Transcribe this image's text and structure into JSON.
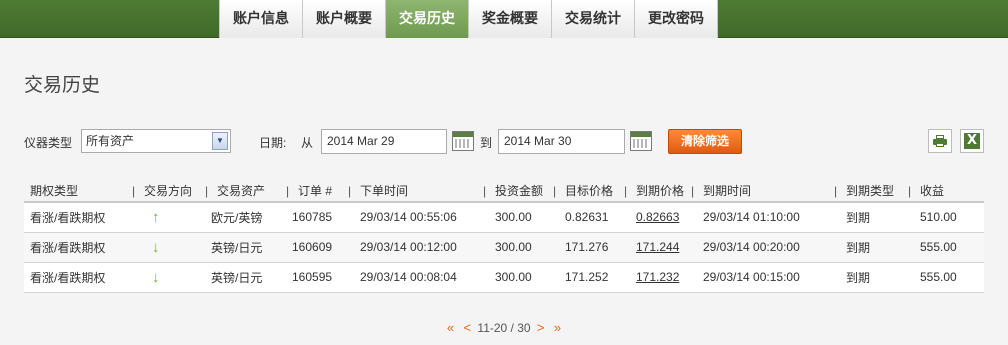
{
  "nav": {
    "tabs": [
      {
        "label": "账户信息",
        "active": false
      },
      {
        "label": "账户概要",
        "active": false
      },
      {
        "label": "交易历史",
        "active": true
      },
      {
        "label": "奖金概要",
        "active": false
      },
      {
        "label": "交易统计",
        "active": false
      },
      {
        "label": "更改密码",
        "active": false
      }
    ]
  },
  "page": {
    "title": "交易历史"
  },
  "filters": {
    "instrument_label": "仪器类型",
    "instrument_value": "所有资产",
    "date_label": "日期:",
    "from_label": "从",
    "from_value": "2014 Mar 29",
    "to_label": "到",
    "to_value": "2014 Mar 30",
    "clear_label": "清除筛选"
  },
  "table": {
    "columns": [
      "期权类型",
      "交易方向",
      "交易资产",
      "订单 #",
      "下单时间",
      "投资金额",
      "目标价格",
      "到期价格",
      "到期时间",
      "到期类型",
      "收益"
    ],
    "rows": [
      {
        "type": "看涨/看跌期权",
        "direction": "↑",
        "asset": "欧元/英镑",
        "order": "160785",
        "placed": "29/03/14 00:55:06",
        "amount": "300.00",
        "target": "0.82631",
        "expiry_price": "0.82663",
        "expiry_time": "29/03/14 01:10:00",
        "expiry_type": "到期",
        "profit": "510.00"
      },
      {
        "type": "看涨/看跌期权",
        "direction": "↓",
        "asset": "英镑/日元",
        "order": "160609",
        "placed": "29/03/14 00:12:00",
        "amount": "300.00",
        "target": "171.276",
        "expiry_price": "171.244",
        "expiry_time": "29/03/14 00:20:00",
        "expiry_type": "到期",
        "profit": "555.00"
      },
      {
        "type": "看涨/看跌期权",
        "direction": "↓",
        "asset": "英镑/日元",
        "order": "160595",
        "placed": "29/03/14 00:08:04",
        "amount": "300.00",
        "target": "171.252",
        "expiry_price": "171.232",
        "expiry_time": "29/03/14 00:15:00",
        "expiry_type": "到期",
        "profit": "555.00"
      }
    ]
  },
  "pager": {
    "first": "«",
    "prev": "<",
    "range": "11-20 / 30",
    "next": ">",
    "last": "»"
  },
  "colors": {
    "nav_bg": "#4e7b34",
    "active_tab": "#7da65d",
    "accent_orange": "#e8631a",
    "arrow_green": "#7fae2f"
  }
}
